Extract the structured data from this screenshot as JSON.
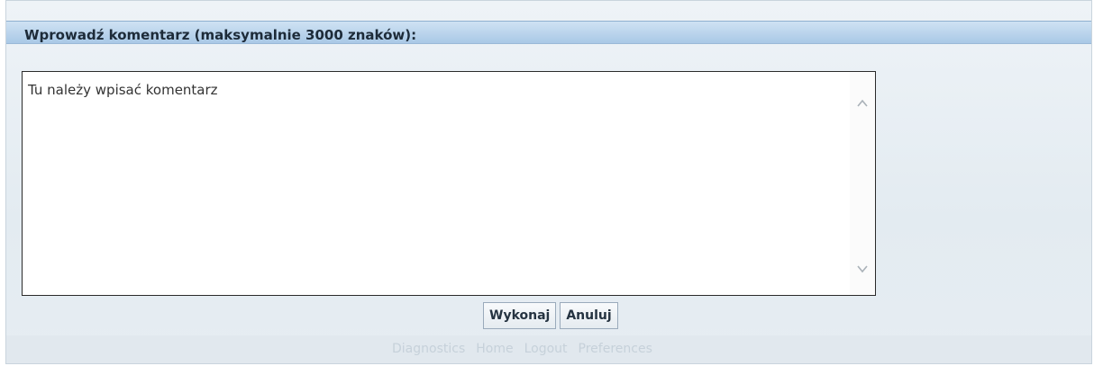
{
  "dialog": {
    "title": "Wprowadź komentarz (maksymalnie 3000 znaków):",
    "comment_value": "Tu należy wpisać komentarz"
  },
  "buttons": {
    "execute": "Wykonaj",
    "cancel": "Anuluj"
  },
  "footer": {
    "links": [
      "Diagnostics",
      "Home",
      "Logout",
      "Preferences"
    ]
  },
  "colors": {
    "header_gradient_top": "#cfe2f3",
    "header_gradient_bottom": "#a9c8e6",
    "panel_background": "#e3ebf1"
  },
  "icons": {
    "scroll_up": "chevron-up-icon",
    "scroll_down": "chevron-down-icon"
  }
}
